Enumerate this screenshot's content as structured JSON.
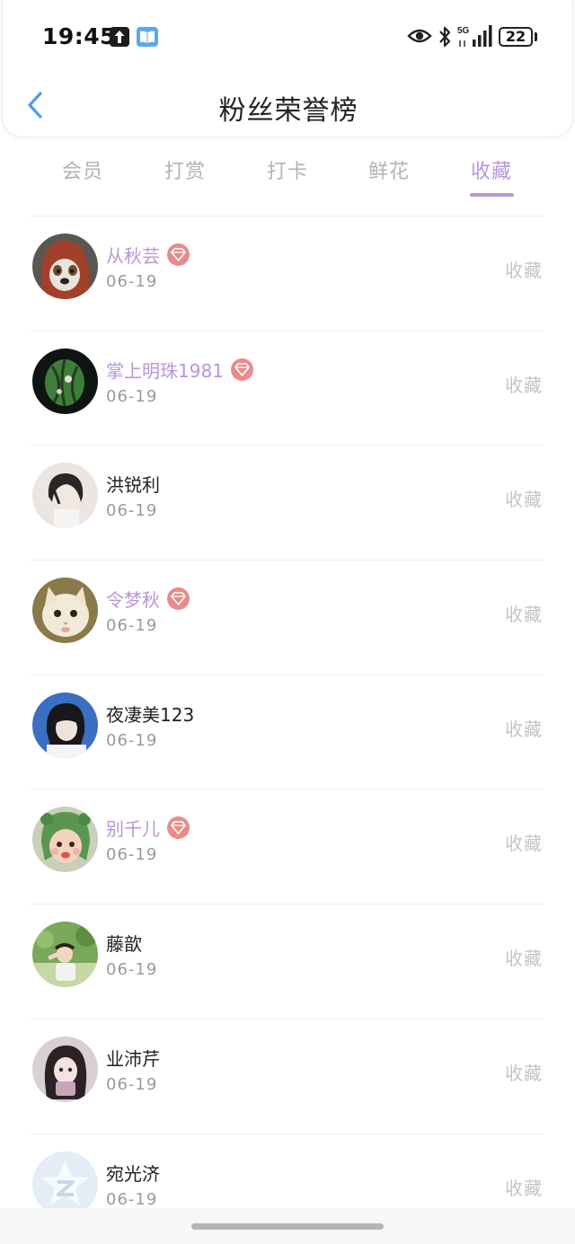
{
  "status_bar": {
    "time": "19:45",
    "network": "5G",
    "battery": "22",
    "icons": [
      "upload-icon",
      "book-icon",
      "eye-icon",
      "bluetooth-icon",
      "signal-icon",
      "battery-icon"
    ]
  },
  "nav": {
    "title": "粉丝荣誉榜",
    "back_icon": "chevron-left-icon"
  },
  "tabs": [
    {
      "label": "会员",
      "active": false
    },
    {
      "label": "打赏",
      "active": false
    },
    {
      "label": "打卡",
      "active": false
    },
    {
      "label": "鲜花",
      "active": false
    },
    {
      "label": "收藏",
      "active": true
    }
  ],
  "colors": {
    "accent": "#b896d8",
    "badge": "#ea8b8b",
    "muted": "#c4c4c4",
    "date": "#9a9a9a"
  },
  "fans": [
    {
      "name": "从秋芸",
      "date": "06-19",
      "action": "收藏",
      "vip": true,
      "avatar": "dog-avatar"
    },
    {
      "name": "掌上明珠1981",
      "date": "06-19",
      "action": "收藏",
      "vip": true,
      "avatar": "watermelon-avatar"
    },
    {
      "name": "洪锐利",
      "date": "06-19",
      "action": "收藏",
      "vip": false,
      "avatar": "girl-avatar"
    },
    {
      "name": "令梦秋",
      "date": "06-19",
      "action": "收藏",
      "vip": true,
      "avatar": "cat-avatar"
    },
    {
      "name": "夜凄美123",
      "date": "06-19",
      "action": "收藏",
      "vip": false,
      "avatar": "girl-avatar"
    },
    {
      "name": "别千儿",
      "date": "06-19",
      "action": "收藏",
      "vip": true,
      "avatar": "child-avatar"
    },
    {
      "name": "藤歆",
      "date": "06-19",
      "action": "收藏",
      "vip": false,
      "avatar": "nature-avatar"
    },
    {
      "name": "业沛芹",
      "date": "06-19",
      "action": "收藏",
      "vip": false,
      "avatar": "girl-avatar"
    },
    {
      "name": "宛光济",
      "date": "06-19",
      "action": "收藏",
      "vip": false,
      "avatar": "default-avatar"
    }
  ]
}
